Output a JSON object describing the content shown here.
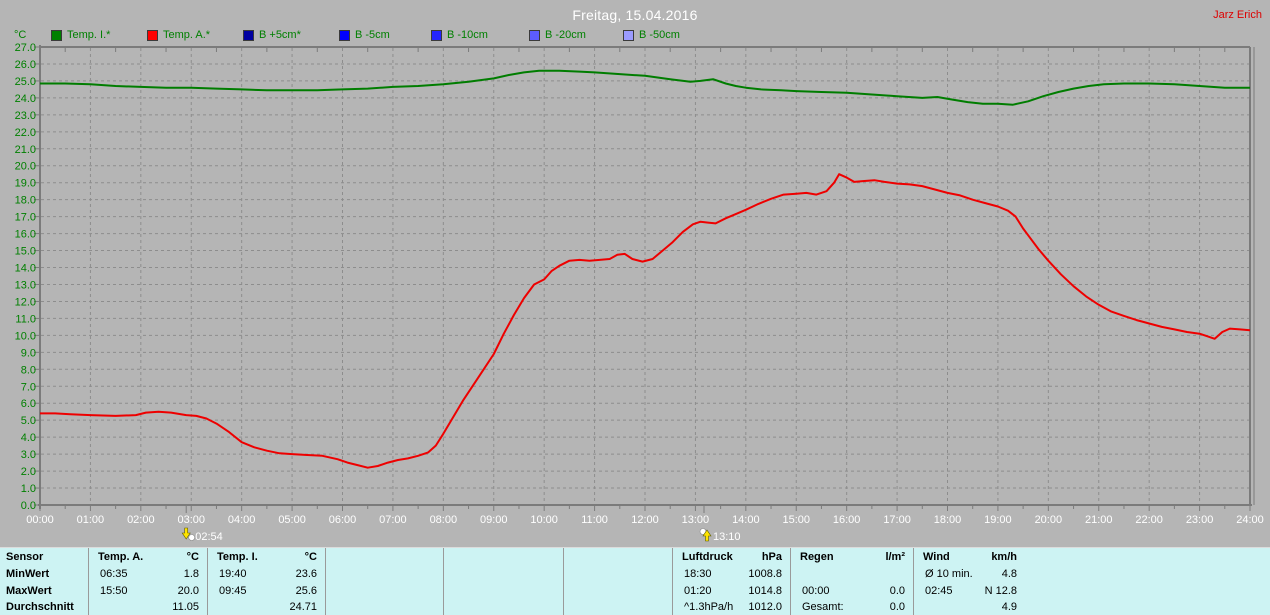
{
  "header": {
    "title": "Freitag, 15.04.2016",
    "user": "Jarz Erich"
  },
  "legend": {
    "unit": "°C",
    "items": [
      {
        "id": "temp-i",
        "label": "Temp. I.*",
        "color": "#008000"
      },
      {
        "id": "temp-a",
        "label": "Temp. A.*",
        "color": "#ff0000"
      },
      {
        "id": "b-plus5",
        "label": "B +5cm*",
        "color": "#0000a0"
      },
      {
        "id": "b-minus5",
        "label": "B -5cm",
        "color": "#0000ff"
      },
      {
        "id": "b-minus10",
        "label": "B -10cm",
        "color": "#2424ff"
      },
      {
        "id": "b-minus20",
        "label": "B -20cm",
        "color": "#5c5cff"
      },
      {
        "id": "b-minus50",
        "label": "B -50cm",
        "color": "#9b9bff"
      }
    ]
  },
  "chart_data": {
    "type": "line",
    "title": "Freitag, 15.04.2016",
    "ylabel": "°C",
    "xlabel": "",
    "ylim": [
      0,
      27
    ],
    "y_step": 1,
    "grid": "dashed",
    "legend_position": "top",
    "y_ticks": [
      "0.0",
      "1.0",
      "2.0",
      "3.0",
      "4.0",
      "5.0",
      "6.0",
      "7.0",
      "8.0",
      "9.0",
      "10.0",
      "11.0",
      "12.0",
      "13.0",
      "14.0",
      "15.0",
      "16.0",
      "17.0",
      "18.0",
      "19.0",
      "20.0",
      "21.0",
      "22.0",
      "23.0",
      "24.0",
      "25.0",
      "26.0",
      "27.0"
    ],
    "x_ticks": [
      "00:00",
      "01:00",
      "02:00",
      "03:00",
      "04:00",
      "05:00",
      "06:00",
      "07:00",
      "08:00",
      "09:00",
      "10:00",
      "11:00",
      "12:00",
      "13:00",
      "14:00",
      "15:00",
      "16:00",
      "17:00",
      "18:00",
      "19:00",
      "20:00",
      "21:00",
      "22:00",
      "23:00",
      "24:00"
    ],
    "series": [
      {
        "name": "Temp. I.*",
        "color": "#007d00",
        "points": [
          [
            0,
            24.85
          ],
          [
            0.5,
            24.85
          ],
          [
            1,
            24.8
          ],
          [
            1.5,
            24.7
          ],
          [
            2,
            24.65
          ],
          [
            2.5,
            24.6
          ],
          [
            3,
            24.6
          ],
          [
            3.5,
            24.55
          ],
          [
            4,
            24.5
          ],
          [
            4.5,
            24.45
          ],
          [
            5,
            24.45
          ],
          [
            5.5,
            24.45
          ],
          [
            6,
            24.5
          ],
          [
            6.5,
            24.55
          ],
          [
            7,
            24.65
          ],
          [
            7.5,
            24.7
          ],
          [
            8,
            24.8
          ],
          [
            8.5,
            24.95
          ],
          [
            9,
            25.15
          ],
          [
            9.3,
            25.35
          ],
          [
            9.6,
            25.5
          ],
          [
            9.9,
            25.6
          ],
          [
            10.3,
            25.6
          ],
          [
            10.7,
            25.55
          ],
          [
            11,
            25.5
          ],
          [
            11.5,
            25.4
          ],
          [
            12,
            25.3
          ],
          [
            12.5,
            25.1
          ],
          [
            12.9,
            24.95
          ],
          [
            13.1,
            25.0
          ],
          [
            13.35,
            25.1
          ],
          [
            13.6,
            24.85
          ],
          [
            13.8,
            24.7
          ],
          [
            14,
            24.6
          ],
          [
            14.3,
            24.5
          ],
          [
            14.7,
            24.45
          ],
          [
            15,
            24.4
          ],
          [
            15.5,
            24.35
          ],
          [
            16,
            24.3
          ],
          [
            16.5,
            24.2
          ],
          [
            17,
            24.1
          ],
          [
            17.5,
            24.0
          ],
          [
            17.8,
            24.05
          ],
          [
            18.1,
            23.9
          ],
          [
            18.4,
            23.75
          ],
          [
            18.7,
            23.65
          ],
          [
            19,
            23.65
          ],
          [
            19.3,
            23.6
          ],
          [
            19.6,
            23.8
          ],
          [
            19.9,
            24.1
          ],
          [
            20.2,
            24.35
          ],
          [
            20.5,
            24.55
          ],
          [
            20.8,
            24.7
          ],
          [
            21.1,
            24.8
          ],
          [
            21.5,
            24.85
          ],
          [
            22,
            24.85
          ],
          [
            22.5,
            24.8
          ],
          [
            23,
            24.7
          ],
          [
            23.5,
            24.6
          ],
          [
            24,
            24.6
          ]
        ]
      },
      {
        "name": "Temp. A.*",
        "color": "#ee0000",
        "points": [
          [
            0,
            5.4
          ],
          [
            0.3,
            5.4
          ],
          [
            0.6,
            5.35
          ],
          [
            1,
            5.3
          ],
          [
            1.5,
            5.25
          ],
          [
            1.9,
            5.3
          ],
          [
            2.1,
            5.45
          ],
          [
            2.35,
            5.5
          ],
          [
            2.6,
            5.45
          ],
          [
            2.9,
            5.3
          ],
          [
            3.1,
            5.25
          ],
          [
            3.3,
            5.1
          ],
          [
            3.5,
            4.8
          ],
          [
            3.75,
            4.3
          ],
          [
            4,
            3.7
          ],
          [
            4.25,
            3.4
          ],
          [
            4.5,
            3.2
          ],
          [
            4.75,
            3.05
          ],
          [
            5,
            3.0
          ],
          [
            5.3,
            2.95
          ],
          [
            5.6,
            2.9
          ],
          [
            5.9,
            2.7
          ],
          [
            6.1,
            2.5
          ],
          [
            6.3,
            2.35
          ],
          [
            6.5,
            2.2
          ],
          [
            6.7,
            2.3
          ],
          [
            6.9,
            2.5
          ],
          [
            7.1,
            2.65
          ],
          [
            7.3,
            2.75
          ],
          [
            7.5,
            2.9
          ],
          [
            7.7,
            3.1
          ],
          [
            7.85,
            3.5
          ],
          [
            8,
            4.2
          ],
          [
            8.2,
            5.2
          ],
          [
            8.4,
            6.2
          ],
          [
            8.6,
            7.1
          ],
          [
            8.8,
            8.0
          ],
          [
            9,
            8.9
          ],
          [
            9.2,
            10.1
          ],
          [
            9.4,
            11.2
          ],
          [
            9.6,
            12.2
          ],
          [
            9.8,
            13.0
          ],
          [
            10,
            13.3
          ],
          [
            10.15,
            13.8
          ],
          [
            10.3,
            14.1
          ],
          [
            10.5,
            14.4
          ],
          [
            10.7,
            14.45
          ],
          [
            10.9,
            14.4
          ],
          [
            11.1,
            14.45
          ],
          [
            11.3,
            14.5
          ],
          [
            11.45,
            14.75
          ],
          [
            11.6,
            14.8
          ],
          [
            11.75,
            14.5
          ],
          [
            11.95,
            14.35
          ],
          [
            12.15,
            14.5
          ],
          [
            12.35,
            15.0
          ],
          [
            12.55,
            15.5
          ],
          [
            12.75,
            16.1
          ],
          [
            12.95,
            16.55
          ],
          [
            13.1,
            16.7
          ],
          [
            13.25,
            16.65
          ],
          [
            13.4,
            16.6
          ],
          [
            13.6,
            16.9
          ],
          [
            13.8,
            17.15
          ],
          [
            14,
            17.4
          ],
          [
            14.25,
            17.75
          ],
          [
            14.5,
            18.05
          ],
          [
            14.75,
            18.3
          ],
          [
            15,
            18.35
          ],
          [
            15.2,
            18.4
          ],
          [
            15.4,
            18.3
          ],
          [
            15.6,
            18.5
          ],
          [
            15.75,
            19.0
          ],
          [
            15.85,
            19.5
          ],
          [
            16,
            19.3
          ],
          [
            16.15,
            19.05
          ],
          [
            16.35,
            19.1
          ],
          [
            16.55,
            19.15
          ],
          [
            16.75,
            19.05
          ],
          [
            17,
            18.95
          ],
          [
            17.25,
            18.9
          ],
          [
            17.5,
            18.8
          ],
          [
            17.75,
            18.6
          ],
          [
            18,
            18.4
          ],
          [
            18.25,
            18.25
          ],
          [
            18.5,
            18.0
          ],
          [
            18.75,
            17.8
          ],
          [
            19,
            17.6
          ],
          [
            19.2,
            17.35
          ],
          [
            19.35,
            17.0
          ],
          [
            19.5,
            16.3
          ],
          [
            19.65,
            15.7
          ],
          [
            19.8,
            15.1
          ],
          [
            20,
            14.4
          ],
          [
            20.25,
            13.6
          ],
          [
            20.5,
            12.9
          ],
          [
            20.75,
            12.3
          ],
          [
            21,
            11.8
          ],
          [
            21.25,
            11.4
          ],
          [
            21.5,
            11.15
          ],
          [
            21.75,
            10.9
          ],
          [
            22,
            10.7
          ],
          [
            22.25,
            10.5
          ],
          [
            22.5,
            10.35
          ],
          [
            22.75,
            10.2
          ],
          [
            23,
            10.1
          ],
          [
            23.15,
            9.95
          ],
          [
            23.3,
            9.8
          ],
          [
            23.45,
            10.2
          ],
          [
            23.6,
            10.4
          ],
          [
            23.8,
            10.35
          ],
          [
            24,
            10.3
          ]
        ]
      }
    ],
    "markers": [
      {
        "time": "02:54",
        "hour": 2.9,
        "type": "moonset"
      },
      {
        "time": "13:10",
        "hour": 13.17,
        "type": "moonrise"
      }
    ]
  },
  "table": {
    "row_labels": [
      "Sensor",
      "MinWert",
      "MaxWert",
      "Durchschnitt"
    ],
    "columns": [
      {
        "id": "temp-a",
        "header": "Temp. A.",
        "unit": "°C",
        "min": [
          "06:35",
          "1.8"
        ],
        "max": [
          "15:50",
          "20.0"
        ],
        "avg": [
          "",
          "11.05"
        ]
      },
      {
        "id": "temp-i",
        "header": "Temp. I.",
        "unit": "°C",
        "min": [
          "19:40",
          "23.6"
        ],
        "max": [
          "09:45",
          "25.6"
        ],
        "avg": [
          "",
          "24.71"
        ]
      },
      {
        "id": "empty-1",
        "header": "",
        "unit": "",
        "min": [
          "",
          ""
        ],
        "max": [
          "",
          ""
        ],
        "avg": [
          "",
          ""
        ]
      },
      {
        "id": "empty-2",
        "header": "",
        "unit": "",
        "min": [
          "",
          ""
        ],
        "max": [
          "",
          ""
        ],
        "avg": [
          "",
          ""
        ]
      },
      {
        "id": "empty-3",
        "header": "",
        "unit": "",
        "min": [
          "",
          ""
        ],
        "max": [
          "",
          ""
        ],
        "avg": [
          "",
          ""
        ]
      },
      {
        "id": "luftdruck",
        "header": "Luftdruck",
        "unit": "hPa",
        "min": [
          "18:30",
          "1008.8"
        ],
        "max": [
          "01:20",
          "1014.8"
        ],
        "avg": [
          "^1.3hPa/h",
          "1012.0"
        ]
      },
      {
        "id": "regen",
        "header": "Regen",
        "unit": "l/m²",
        "min": [
          "",
          ""
        ],
        "max": [
          "00:00",
          "0.0"
        ],
        "avg": [
          "Gesamt:",
          "0.0"
        ]
      },
      {
        "id": "wind",
        "header": "Wind",
        "unit": "km/h",
        "min": [
          "Ø 10 min.",
          "4.8"
        ],
        "max": [
          "02:45",
          "N 12.8"
        ],
        "avg": [
          "",
          "4.9"
        ]
      }
    ]
  },
  "colors": {
    "background": "#b5b5b5",
    "grid": "#8d8d8d",
    "frame": "#7b7b7b",
    "y_label_text": "#008000",
    "x_label_text": "#ffffff",
    "title_text": "#ffffff",
    "user_text": "#dd0000",
    "table_background": "#cdf3f3"
  }
}
